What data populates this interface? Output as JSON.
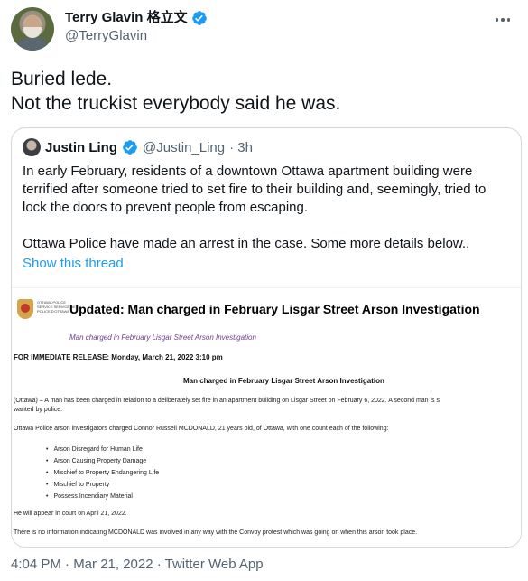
{
  "author": {
    "display_name": "Terry Glavin 格立文",
    "handle": "@TerryGlavin"
  },
  "tweet": {
    "line1": "Buried lede.",
    "line2": "Not the truckist everybody said he was."
  },
  "quoted": {
    "display_name": "Justin Ling",
    "handle": "@Justin_Ling",
    "time": "· 3h",
    "paragraph1": "In early February, residents of a downtown Ottawa apartment building were terrified after someone tried to set fire to their building and, seemingly, tried to lock the doors to prevent people from escaping.",
    "paragraph2": "Ottawa Police have made an arrest in the case. Some more details below..",
    "show_thread": "Show this thread"
  },
  "document": {
    "dept": "OTTAWA POLICE SERVICE SERVICE DE POLICE D'OTTAWA",
    "headline": "Updated: Man charged in February Lisgar Street Arson Investigation",
    "sub": "Man charged in February Lisgar Street Arson Investigation",
    "release": "FOR IMMEDIATE RELEASE: Monday, March 21, 2022    3:10 pm",
    "title2": "Man charged in February Lisgar Street Arson Investigation",
    "para1": "(Ottawa) – A man has been charged in relation to a deliberately set fire in an apartment building on Lisgar Street on February 6, 2022. A second man is s",
    "para1b": "wanted by police.",
    "para2": "Ottawa Police arson investigators charged Connor Russell MCDONALD, 21 years old, of Ottawa, with one count each of the following:",
    "charges": [
      "Arson Disregard for Human Life",
      "Arson Causing Property Damage",
      "Mischief to Property Endangering Life",
      "Mischief to Property",
      "Possess Incendiary Material"
    ],
    "para3": "He will appear in court on April 21, 2022.",
    "para4": "There is no information indicating MCDONALD was involved in any way with the Convoy protest which was going on when this arson took place."
  },
  "timestamp": "4:04 PM · Mar 21, 2022 · Twitter Web App",
  "icons": [
    "verified-icon",
    "more-icon"
  ],
  "colors": {
    "accent": "#1d9bf0",
    "muted": "#536471"
  }
}
